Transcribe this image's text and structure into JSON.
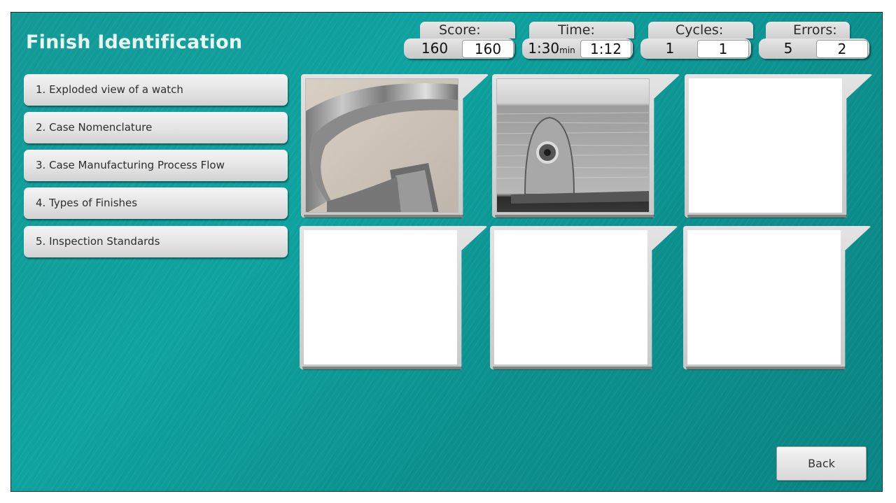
{
  "title": "Finish Identification",
  "stats": {
    "score": {
      "label": "Score:",
      "max": "160",
      "current": "160"
    },
    "time": {
      "label": "Time:",
      "limit": "1:30",
      "limit_unit": "min",
      "current": "1:12"
    },
    "cycles": {
      "label": "Cycles:",
      "max": "1",
      "current": "1"
    },
    "errors": {
      "label": "Errors:",
      "max": "5",
      "current": "2"
    }
  },
  "menu": [
    {
      "label": "1. Exploded view of a watch"
    },
    {
      "label": "2. Case Nomenclature"
    },
    {
      "label": "3. Case Manufacturing Process Flow"
    },
    {
      "label": "4. Types of Finishes"
    },
    {
      "label": "5. Inspection Standards"
    }
  ],
  "cards": [
    {
      "state": "revealed",
      "image": "polished-watch-bezel-ring-photo"
    },
    {
      "state": "revealed",
      "image": "brushed-case-lug-hole-photo"
    },
    {
      "state": "blank"
    },
    {
      "state": "blank"
    },
    {
      "state": "blank"
    },
    {
      "state": "blank"
    }
  ],
  "back_label": "Back",
  "colors": {
    "background": "#0fa3a0",
    "title": "#e9f7f1",
    "panel": "#d9d9d9"
  }
}
